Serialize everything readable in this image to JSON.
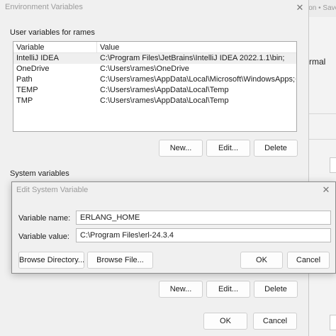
{
  "background_app": {
    "top_text": "ion • Save",
    "normal_text": "rmal"
  },
  "env_window": {
    "title": "Environment Variables",
    "close_glyph": "✕",
    "user_section_label": "User variables for rames",
    "user_table": {
      "columns": [
        "Variable",
        "Value"
      ],
      "rows": [
        {
          "variable": "IntelliJ IDEA",
          "value": "C:\\Program Files\\JetBrains\\IntelliJ IDEA 2022.1.1\\bin;"
        },
        {
          "variable": "OneDrive",
          "value": "C:\\Users\\rames\\OneDrive"
        },
        {
          "variable": "Path",
          "value": "C:\\Users\\rames\\AppData\\Local\\Microsoft\\WindowsApps;C:\\Prog..."
        },
        {
          "variable": "TEMP",
          "value": "C:\\Users\\rames\\AppData\\Local\\Temp"
        },
        {
          "variable": "TMP",
          "value": "C:\\Users\\rames\\AppData\\Local\\Temp"
        }
      ]
    },
    "user_buttons": {
      "new": "New...",
      "edit": "Edit...",
      "delete": "Delete"
    },
    "system_section_label": "System variables",
    "system_buttons": {
      "new": "New...",
      "edit": "Edit...",
      "delete": "Delete"
    },
    "footer_buttons": {
      "ok": "OK",
      "cancel": "Cancel"
    }
  },
  "edit_dialog": {
    "title": "Edit System Variable",
    "close_glyph": "✕",
    "name_label": "Variable name:",
    "name_value": "ERLANG_HOME",
    "value_label": "Variable value:",
    "value_value": "C:\\Program Files\\erl-24.3.4",
    "buttons": {
      "browse_directory": "Browse Directory...",
      "browse_file": "Browse File...",
      "ok": "OK",
      "cancel": "Cancel"
    }
  }
}
